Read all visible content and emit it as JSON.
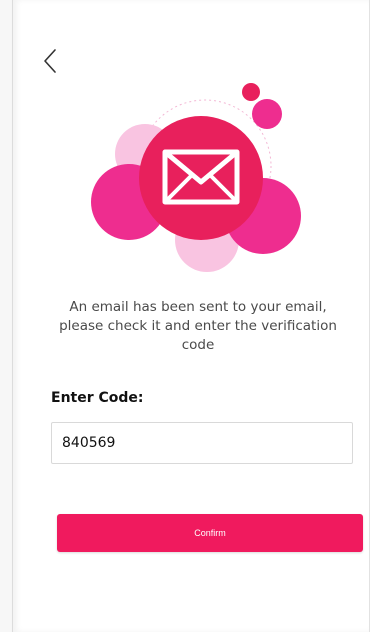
{
  "screen": {
    "back_icon": "chevron-left-icon",
    "illustration_icon": "envelope-icon"
  },
  "message": {
    "text": "An email has been sent to your email, please check it and enter the verification code"
  },
  "form": {
    "code_label": "Enter Code:",
    "code_value": "840569",
    "confirm_label": "Confirm"
  },
  "colors": {
    "accent": "#f01a5e",
    "circle_main": "#e8205c",
    "circle_magenta": "#ee2d8f",
    "circle_light": "#f7b3da"
  }
}
